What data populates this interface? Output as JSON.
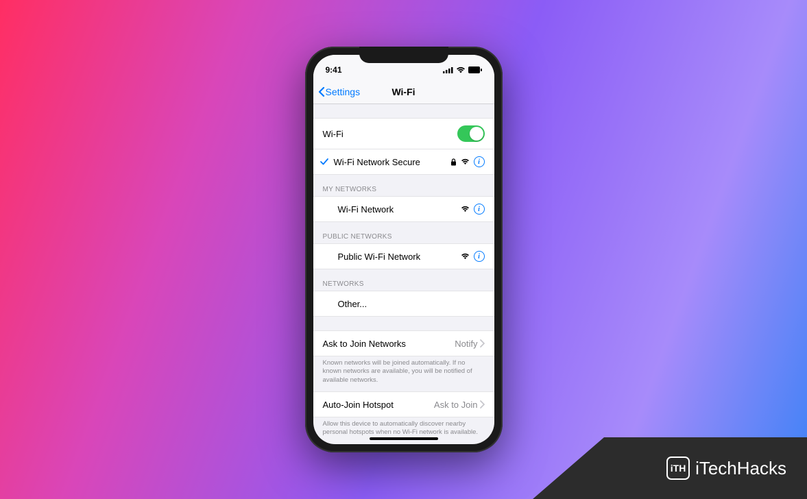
{
  "status": {
    "time": "9:41"
  },
  "nav": {
    "back": "Settings",
    "title": "Wi-Fi"
  },
  "wifi": {
    "toggle_label": "Wi-Fi",
    "connected": {
      "name": "Wi-Fi Network Secure"
    }
  },
  "sections": {
    "my_networks": {
      "header": "MY NETWORKS",
      "items": [
        {
          "name": "Wi-Fi Network"
        }
      ]
    },
    "public_networks": {
      "header": "PUBLIC NETWORKS",
      "items": [
        {
          "name": "Public Wi-Fi Network"
        }
      ]
    },
    "networks": {
      "header": "NETWORKS",
      "other_label": "Other..."
    }
  },
  "ask_join": {
    "label": "Ask to Join Networks",
    "value": "Notify",
    "footer": "Known networks will be joined automatically. If no known networks are available, you will be notified of available networks."
  },
  "auto_hotspot": {
    "label": "Auto-Join Hotspot",
    "value": "Ask to Join",
    "footer": "Allow this device to automatically discover nearby personal hotspots when no Wi-Fi network is available."
  },
  "watermark": {
    "brand": "iTechHacks",
    "logo": "iTH"
  }
}
